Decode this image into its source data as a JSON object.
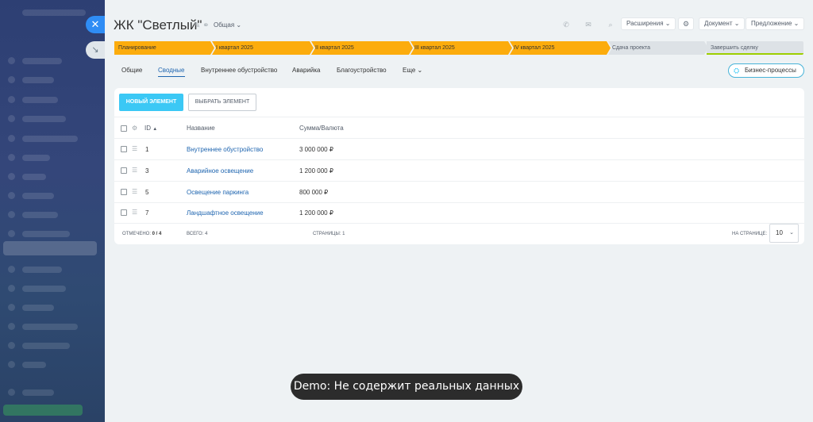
{
  "window": {
    "title": "ЖК \"Светлый\"",
    "category": "Общая"
  },
  "toolbar": {
    "extensions": "Расширения",
    "document": "Документ",
    "proposal": "Предложение"
  },
  "stages": [
    {
      "label": "Планирование",
      "state": "done"
    },
    {
      "label": "I квартал 2025",
      "state": "done"
    },
    {
      "label": "II квартал 2025",
      "state": "done"
    },
    {
      "label": "III квартал 2025",
      "state": "done"
    },
    {
      "label": "IV квартал 2025",
      "state": "done"
    },
    {
      "label": "Сдача проекта",
      "state": "todo"
    },
    {
      "label": "Завершить сделку",
      "state": "final"
    }
  ],
  "colors": {
    "stage_done": "#fcac0d",
    "stage_todo": "#dde2e6",
    "accent": "#3bc8f5",
    "link": "#2066b0",
    "close": "#2f8df5"
  },
  "tabs": [
    {
      "label": "Общие"
    },
    {
      "label": "Сводные",
      "active": true
    },
    {
      "label": "Внутреннее обустройство"
    },
    {
      "label": "Аварийка"
    },
    {
      "label": "Благоустройство"
    },
    {
      "label": "Еще"
    }
  ],
  "business_process_label": "Бизнес-процессы",
  "list": {
    "new_button": "НОВЫЙ ЭЛЕМЕНТ",
    "select_button": "ВЫБРАТЬ ЭЛЕМЕНТ",
    "columns": {
      "id": "ID",
      "name": "Название",
      "sum": "Сумма/Валюта"
    },
    "rows": [
      {
        "id": "1",
        "name": "Внутреннее обустройство",
        "sum": "3 000 000 ₽"
      },
      {
        "id": "3",
        "name": "Аварийное освещение",
        "sum": "1 200 000 ₽"
      },
      {
        "id": "5",
        "name": "Освещение паркинга",
        "sum": "800 000 ₽"
      },
      {
        "id": "7",
        "name": "Ландшафтное освещение",
        "sum": "1 200 000 ₽"
      }
    ],
    "footer": {
      "marked_label": "ОТМЕЧЕНО:",
      "marked_value": "0 / 4",
      "total_label": "ВСЕГО:",
      "total_value": "4",
      "pages_label": "СТРАНИЦЫ:",
      "pages_value": "1",
      "per_page_label": "НА СТРАНИЦЕ:",
      "per_page_value": "10"
    }
  },
  "toast": "Demo: Не содержит реальных данных"
}
